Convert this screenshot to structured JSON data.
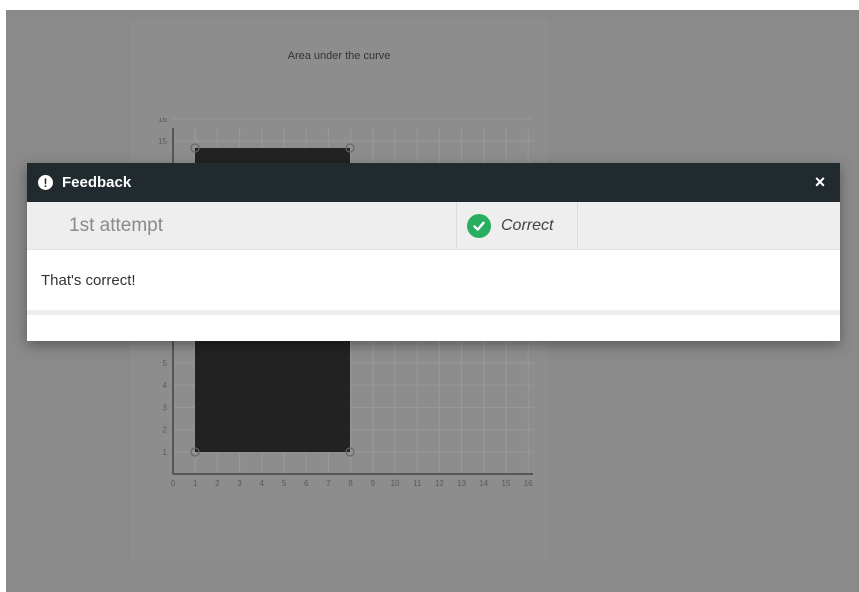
{
  "graph": {
    "title": "Area under the curve",
    "x_ticks": [
      "0",
      "1",
      "2",
      "3",
      "4",
      "5",
      "6",
      "7",
      "8",
      "9",
      "10",
      "11",
      "12",
      "13",
      "14",
      "15",
      "16"
    ],
    "y_ticks": [
      "1",
      "2",
      "3",
      "4",
      "5",
      "15",
      "16"
    ]
  },
  "modal": {
    "title": "Feedback",
    "close_label": "×",
    "attempt_label": "1st attempt",
    "result_label": "Correct",
    "message": "That's correct!"
  },
  "colors": {
    "overlay": "#8a8a8a",
    "header_bg": "#212a2e",
    "success": "#27ae60",
    "shape_fill": "#222222"
  },
  "icons": {
    "header": "exclamation-circle-icon",
    "close": "close-icon",
    "result": "check-circle-icon"
  }
}
